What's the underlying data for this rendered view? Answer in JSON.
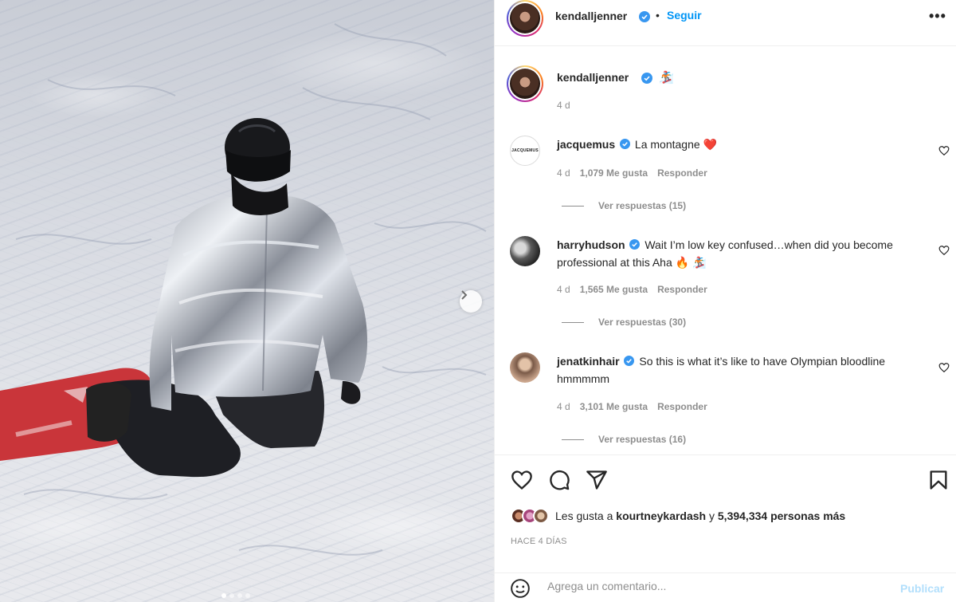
{
  "post": {
    "author": "kendalljenner",
    "follow_label": "Seguir",
    "separator": "•",
    "more_icon": "more-horizontal-icon",
    "caption_emoji": "🏂",
    "caption_time": "4 d",
    "carousel_dots": 4,
    "carousel_active": 0
  },
  "comments": [
    {
      "user": "jacquemus",
      "avatar_text": "JACQUEMUS",
      "text": "La montagne",
      "emoji": "❤️",
      "time": "4 d",
      "likes": "1,079 Me gusta",
      "reply": "Responder",
      "view_replies": "Ver respuestas (15)"
    },
    {
      "user": "harryhudson",
      "text": "Wait I’m low key confused…when did you become professional at this Aha",
      "emoji": "🔥 🏂",
      "time": "4 d",
      "likes": "1,565 Me gusta",
      "reply": "Responder",
      "view_replies": "Ver respuestas (30)"
    },
    {
      "user": "jenatkinhair",
      "text": "So this is what it’s like to have Olympian bloodline hmmmmm",
      "time": "4 d",
      "likes": "3,101 Me gusta",
      "reply": "Responder",
      "view_replies": "Ver respuestas (16)"
    }
  ],
  "likes": {
    "prefix": "Les gusta a",
    "user": "kourtneykardash",
    "connector": "y",
    "count": "5,394,334 personas más"
  },
  "time_ago": "HACE 4 DÍAS",
  "comment_box": {
    "placeholder": "Agrega un comentario...",
    "publish_label": "Publicar"
  },
  "colors": {
    "link_blue": "#0095f6",
    "verified_blue": "#3897f0",
    "muted": "#8e8e8e",
    "publish_disabled": "#b2dffc"
  }
}
